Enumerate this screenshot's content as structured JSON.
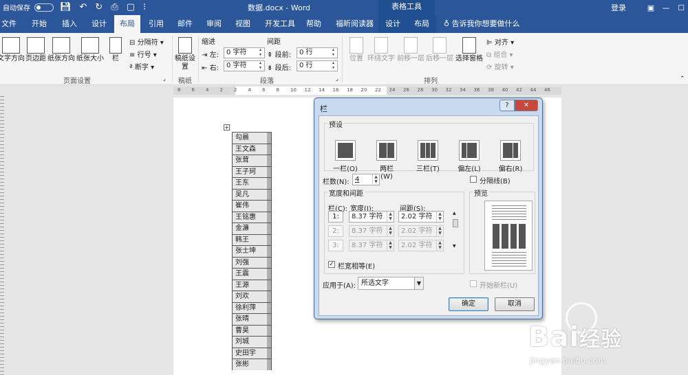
{
  "window": {
    "autosave_label": "自动保存",
    "autosave_state": "关",
    "doc_title": "数据.docx - Word",
    "context_group": "表格工具",
    "login": "登录"
  },
  "tabs": [
    {
      "label": "文件"
    },
    {
      "label": "开始"
    },
    {
      "label": "插入"
    },
    {
      "label": "设计"
    },
    {
      "label": "布局",
      "active": true
    },
    {
      "label": "引用"
    },
    {
      "label": "邮件"
    },
    {
      "label": "审阅"
    },
    {
      "label": "视图"
    },
    {
      "label": "开发工具"
    },
    {
      "label": "帮助"
    },
    {
      "label": "福昕阅读器"
    },
    {
      "label": "设计",
      "context": true
    },
    {
      "label": "布局",
      "context": true
    }
  ],
  "tell_me": "告诉我你想要做什么",
  "ribbon": {
    "page_setup": {
      "text_direction": "文字方向",
      "margins": "页边距",
      "orientation": "纸张方向",
      "size": "纸张大小",
      "columns": "栏",
      "breaks": "分隔符",
      "line_numbers": "行号",
      "hyphenation": "断字",
      "group_label": "页面设置"
    },
    "draft": {
      "button": "稿纸设置",
      "group_label": "稿纸"
    },
    "paragraph": {
      "indent_title": "缩进",
      "spacing_title": "间距",
      "left_label": "左:",
      "right_label": "右:",
      "before_label": "段前:",
      "after_label": "段后:",
      "left_value": "0 字符",
      "right_value": "0 字符",
      "before_value": "0 行",
      "after_value": "0 行",
      "group_label": "段落"
    },
    "arrange": {
      "position": "位置",
      "wrap_text": "环绕文字",
      "bring_forward": "前移一层",
      "send_backward": "后移一层",
      "selection_pane": "选择窗格",
      "align": "对齐",
      "group": "组合",
      "rotate": "旋转",
      "group_label": "排列"
    }
  },
  "ruler_ticks": [
    "8",
    "6",
    "4",
    "2",
    "2",
    "4",
    "6",
    "8",
    "10",
    "12",
    "14",
    "16",
    "18",
    "20",
    "22",
    "24",
    "26",
    "28",
    "30",
    "32",
    "34",
    "36",
    "38",
    "40",
    "42",
    "44",
    "46"
  ],
  "names": [
    "勾晨",
    "王文森",
    "张茸",
    "王子珂",
    "王东",
    "吴凡",
    "崔伟",
    "王铭惠",
    "金濂",
    "韩王",
    "张士坤",
    "刘强",
    "王震",
    "王源",
    "刘欢",
    "徐利萍",
    "张晴",
    "曹昊",
    "刘城",
    "史田宇",
    "张彬"
  ],
  "dialog": {
    "title": "栏",
    "help": "?",
    "close": "✕",
    "presets_label": "预设",
    "presets": [
      {
        "label": "一栏(O)",
        "cols": 1
      },
      {
        "label": "两栏(W)",
        "cols": 2
      },
      {
        "label": "三栏(T)",
        "cols": 3
      },
      {
        "label": "偏左(L)",
        "cols": 2
      },
      {
        "label": "偏右(R)",
        "cols": 2
      }
    ],
    "num_cols_label": "栏数(N):",
    "num_cols_value": "4",
    "line_between_label": "分隔线(B)",
    "width_spacing_label": "宽度和间距",
    "col_header": "栏(C):",
    "width_header": "宽度(I):",
    "spacing_header": "间距(S):",
    "rows": [
      {
        "num": "1:",
        "width": "8.37 字符",
        "spacing": "2.02 字符"
      },
      {
        "num": "2:",
        "width": "8.37 字符",
        "spacing": "2.02 字符"
      },
      {
        "num": "3:",
        "width": "8.37 字符",
        "spacing": "2.02 字符"
      }
    ],
    "equal_width_label": "栏宽相等(E)",
    "preview_label": "预览",
    "apply_to_label": "应用于(A):",
    "apply_to_value": "所选文字",
    "start_new_col_label": "开始新栏(U)",
    "ok": "确定",
    "cancel": "取消"
  },
  "watermark": {
    "brand": "Bai",
    "brand2": "经验",
    "url": "jingyan.baidu.com"
  }
}
